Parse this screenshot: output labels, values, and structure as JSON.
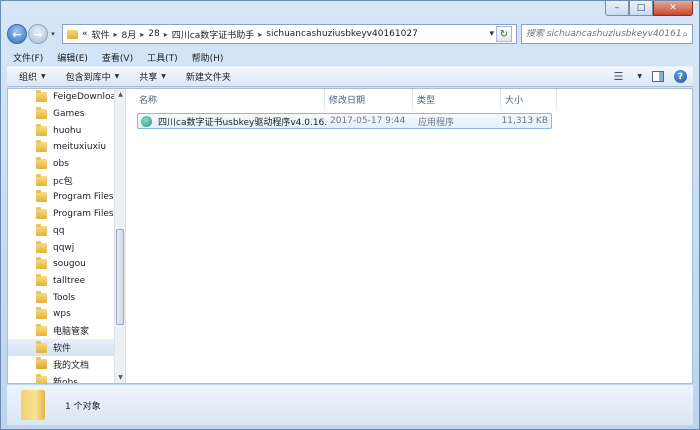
{
  "address": {
    "back_arrow": "«",
    "crumbs": [
      "软件",
      "8月",
      "28",
      "四川ca数字证书助手",
      "sichuancashuziusbkeyv40161027"
    ],
    "dropdown": "▾"
  },
  "search": {
    "placeholder": "搜索 sichuancashuziusbkeyv40161..."
  },
  "menu": [
    "文件(F)",
    "编辑(E)",
    "查看(V)",
    "工具(T)",
    "帮助(H)"
  ],
  "toolbar": [
    "组织",
    "包含到库中",
    "共享",
    "新建文件夹"
  ],
  "nav": {
    "items": [
      "FeigeDownloa",
      "Games",
      "huohu",
      "meituxiuxiu",
      "obs",
      "pc包",
      "Program Files",
      "Program Files",
      "qq",
      "qqwj",
      "sougou",
      "talltree",
      "Tools",
      "wps",
      "电脑管家",
      "软件",
      "我的文档",
      "新obs"
    ],
    "selected_index": 15
  },
  "columns": {
    "name": "名称",
    "date": "修改日期",
    "type": "类型",
    "size": "大小"
  },
  "files": [
    {
      "name": "四川ca数字证书usbkey驱动程序v4.0.16....",
      "date": "2017-05-17 9:44",
      "type": "应用程序",
      "size": "11,313 KB"
    }
  ],
  "status": {
    "count": "1 个对象"
  },
  "icons": {
    "folder": "folder-icon",
    "app": "app-icon",
    "search": "search-icon",
    "help": "help-icon"
  }
}
